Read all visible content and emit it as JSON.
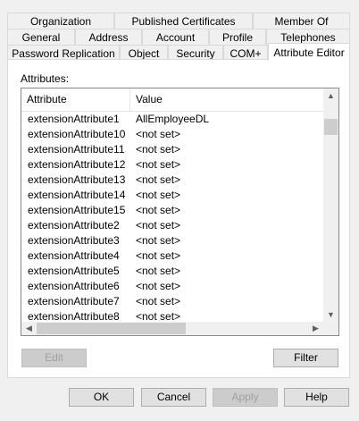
{
  "tabs_row1": [
    {
      "label": "Organization"
    },
    {
      "label": "Published Certificates"
    },
    {
      "label": "Member Of"
    }
  ],
  "tabs_row2": [
    {
      "label": "General"
    },
    {
      "label": "Address"
    },
    {
      "label": "Account"
    },
    {
      "label": "Profile"
    },
    {
      "label": "Telephones"
    }
  ],
  "tabs_row3": [
    {
      "label": "Password Replication"
    },
    {
      "label": "Object"
    },
    {
      "label": "Security"
    },
    {
      "label": "COM+"
    },
    {
      "label": "Attribute Editor"
    }
  ],
  "attributes_label": "Attributes:",
  "list": {
    "col_attribute": "Attribute",
    "col_value": "Value",
    "rows": [
      {
        "attr": "extensionAttribute1",
        "value": "AllEmployeeDL"
      },
      {
        "attr": "extensionAttribute10",
        "value": "<not set>"
      },
      {
        "attr": "extensionAttribute11",
        "value": "<not set>"
      },
      {
        "attr": "extensionAttribute12",
        "value": "<not set>"
      },
      {
        "attr": "extensionAttribute13",
        "value": "<not set>"
      },
      {
        "attr": "extensionAttribute14",
        "value": "<not set>"
      },
      {
        "attr": "extensionAttribute15",
        "value": "<not set>"
      },
      {
        "attr": "extensionAttribute2",
        "value": "<not set>"
      },
      {
        "attr": "extensionAttribute3",
        "value": "<not set>"
      },
      {
        "attr": "extensionAttribute4",
        "value": "<not set>"
      },
      {
        "attr": "extensionAttribute5",
        "value": "<not set>"
      },
      {
        "attr": "extensionAttribute6",
        "value": "<not set>"
      },
      {
        "attr": "extensionAttribute7",
        "value": "<not set>"
      },
      {
        "attr": "extensionAttribute8",
        "value": "<not set>"
      }
    ]
  },
  "buttons": {
    "edit": "Edit",
    "filter": "Filter",
    "ok": "OK",
    "cancel": "Cancel",
    "apply": "Apply",
    "help": "Help"
  }
}
